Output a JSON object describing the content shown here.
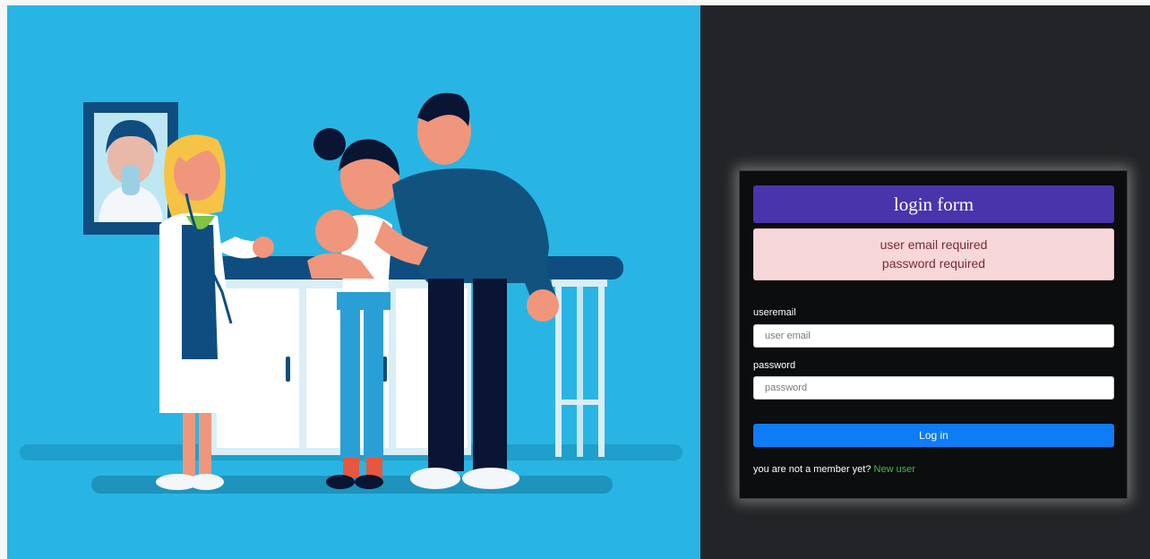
{
  "login": {
    "title": "login form",
    "errors": [
      "user email required",
      "password required"
    ],
    "email_label": "useremail",
    "email_placeholder": "user email",
    "email_value": "",
    "password_label": "password",
    "password_placeholder": "password",
    "password_value": "",
    "submit_label": "Log in",
    "signup_prompt": "you are not a member yet?",
    "signup_link": "New user"
  },
  "colors": {
    "hero_bg": "#29b5e3",
    "panel_bg": "#222427",
    "card_bg": "#0c0d0e",
    "header_bg": "#4a34ab",
    "alert_bg": "#f7d7da",
    "button_bg": "#0d7cf5",
    "link_color": "#3ebc4f"
  }
}
